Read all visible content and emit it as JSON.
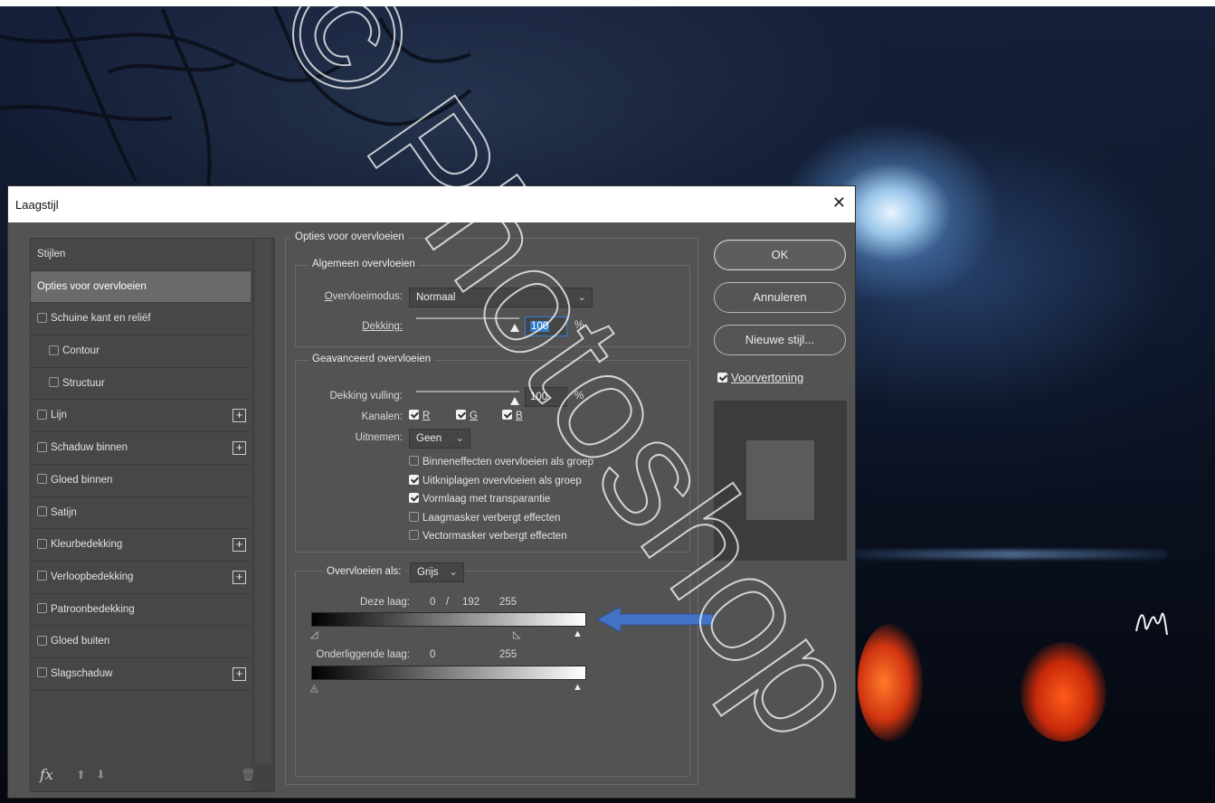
{
  "dialog": {
    "title": "Laagstijl",
    "close_glyph": "✕"
  },
  "left_panel": {
    "items": [
      {
        "label": "Stijlen",
        "checkbox": false,
        "indent": false,
        "plus": false,
        "selected": false
      },
      {
        "label": "Opties voor overvloeien",
        "checkbox": false,
        "indent": false,
        "plus": false,
        "selected": true
      },
      {
        "label": "Schuine kant en reliëf",
        "checkbox": true,
        "indent": false,
        "plus": false,
        "selected": false
      },
      {
        "label": "Contour",
        "checkbox": true,
        "indent": true,
        "plus": false,
        "selected": false
      },
      {
        "label": "Structuur",
        "checkbox": true,
        "indent": true,
        "plus": false,
        "selected": false
      },
      {
        "label": "Lijn",
        "checkbox": true,
        "indent": false,
        "plus": true,
        "selected": false
      },
      {
        "label": "Schaduw binnen",
        "checkbox": true,
        "indent": false,
        "plus": true,
        "selected": false
      },
      {
        "label": "Gloed binnen",
        "checkbox": true,
        "indent": false,
        "plus": false,
        "selected": false
      },
      {
        "label": "Satijn",
        "checkbox": true,
        "indent": false,
        "plus": false,
        "selected": false
      },
      {
        "label": "Kleurbedekking",
        "checkbox": true,
        "indent": false,
        "plus": true,
        "selected": false
      },
      {
        "label": "Verloopbedekking",
        "checkbox": true,
        "indent": false,
        "plus": true,
        "selected": false
      },
      {
        "label": "Patroonbedekking",
        "checkbox": true,
        "indent": false,
        "plus": false,
        "selected": false
      },
      {
        "label": "Gloed buiten",
        "checkbox": true,
        "indent": false,
        "plus": false,
        "selected": false
      },
      {
        "label": "Slagschaduw",
        "checkbox": true,
        "indent": false,
        "plus": true,
        "selected": false
      }
    ],
    "plus_glyph": "+",
    "fx_label": "fx",
    "up_glyph": "⬆",
    "down_glyph": "⬇",
    "trash_glyph": "🗑"
  },
  "blending": {
    "section_title": "Opties voor overvloeien",
    "general": {
      "legend": "Algemeen overvloeien",
      "mode_label": "Overvloeimodus:",
      "mode_value": "Normaal",
      "opacity_label": "Dekking:",
      "opacity_value": "100",
      "percent": "%"
    },
    "advanced": {
      "legend": "Geavanceerd overvloeien",
      "fill_label": "Dekking vulling:",
      "fill_value": "100",
      "percent": "%",
      "channels_label": "Kanalen:",
      "channels": [
        {
          "label": "R",
          "checked": true
        },
        {
          "label": "G",
          "checked": true
        },
        {
          "label": "B",
          "checked": true
        }
      ],
      "knockout_label": "Uitnemen:",
      "knockout_value": "Geen",
      "options": [
        {
          "label": "Binneneffecten overvloeien als groep",
          "checked": false
        },
        {
          "label": "Uitkniplagen overvloeien als groep",
          "checked": true
        },
        {
          "label": "Vormlaag met transparantie",
          "checked": true
        },
        {
          "label": "Laagmasker verbergt effecten",
          "checked": false
        },
        {
          "label": "Vectormasker verbergt effecten",
          "checked": false
        }
      ]
    },
    "blend_if": {
      "label": "Overvloeien als:",
      "value": "Grijs",
      "this_layer_label": "Deze laag:",
      "this_layer_low": "0",
      "this_layer_sep": "/",
      "this_layer_mid": "192",
      "this_layer_high": "255",
      "underlying_label": "Onderliggende laag:",
      "underlying_low": "0",
      "underlying_high": "255"
    }
  },
  "buttons": {
    "ok": "OK",
    "cancel": "Annuleren",
    "new_style": "Nieuwe stijl...",
    "preview_label": "Voorvertoning",
    "preview_checked": true
  },
  "watermark_text": "© Photoshop",
  "colors": {
    "dialog_bg": "#535353",
    "accent_blue": "#2f79c9",
    "arrow_blue": "#4472c4"
  }
}
